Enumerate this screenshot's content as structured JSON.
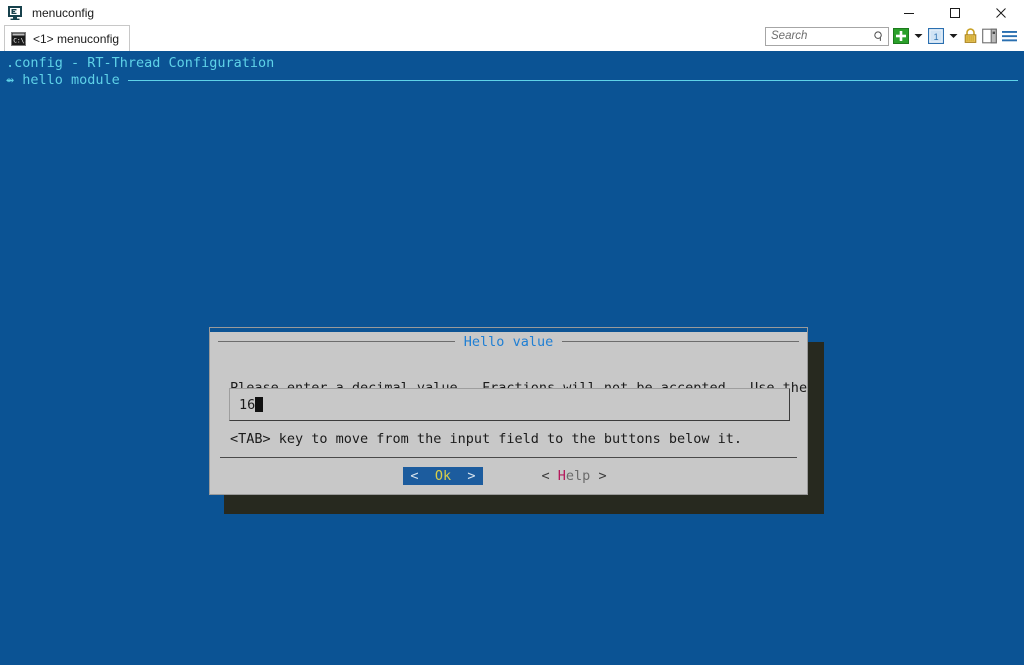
{
  "window": {
    "title": "menuconfig",
    "app_icon": "console-monitor-icon",
    "controls": {
      "minimize": "minimize-icon",
      "maximize": "maximize-icon",
      "close": "close-icon"
    }
  },
  "tabs": [
    {
      "label": "<1> menuconfig",
      "icon": "console-icon",
      "active": true
    }
  ],
  "toolbar": {
    "search": {
      "placeholder": "Search",
      "value": "",
      "icon": "search-icon"
    },
    "new_tab": {
      "icon": "plus-icon",
      "caret": "chevron-down-icon"
    },
    "pane": {
      "icon": "panel-one-icon",
      "label": "1",
      "caret": "chevron-down-icon"
    },
    "lock": {
      "icon": "lock-icon"
    },
    "split": {
      "icon": "split-panel-icon"
    },
    "menu": {
      "icon": "hamburger-menu-icon"
    }
  },
  "terminal": {
    "header_line": ".config - RT-Thread Configuration",
    "breadcrumb_arrow": "⇴",
    "breadcrumb": "hello module",
    "background_color": "#0b5394",
    "text_color": "#5fd2e8"
  },
  "dialog": {
    "title": "Hello value",
    "title_color": "#1f7fd4",
    "prompt_line_1": "Please enter a decimal value.  Fractions will not be accepted.  Use the",
    "prompt_line_2": "<TAB> key to move from the input field to the buttons below it.",
    "input": {
      "value": "16",
      "cursor": "block-cursor"
    },
    "buttons": [
      {
        "open_bracket": "<",
        "hotkey": "O",
        "rest": "k",
        "close_bracket": ">",
        "selected": true,
        "name": "ok-button"
      },
      {
        "open_bracket": "<",
        "hotkey": "H",
        "rest": "elp",
        "close_bracket": ">",
        "selected": false,
        "name": "help-button"
      }
    ],
    "selected_bg_color": "#1c5c9e",
    "selected_text_color": "#d8cf4a",
    "hotkey_color": "#b5185c"
  }
}
